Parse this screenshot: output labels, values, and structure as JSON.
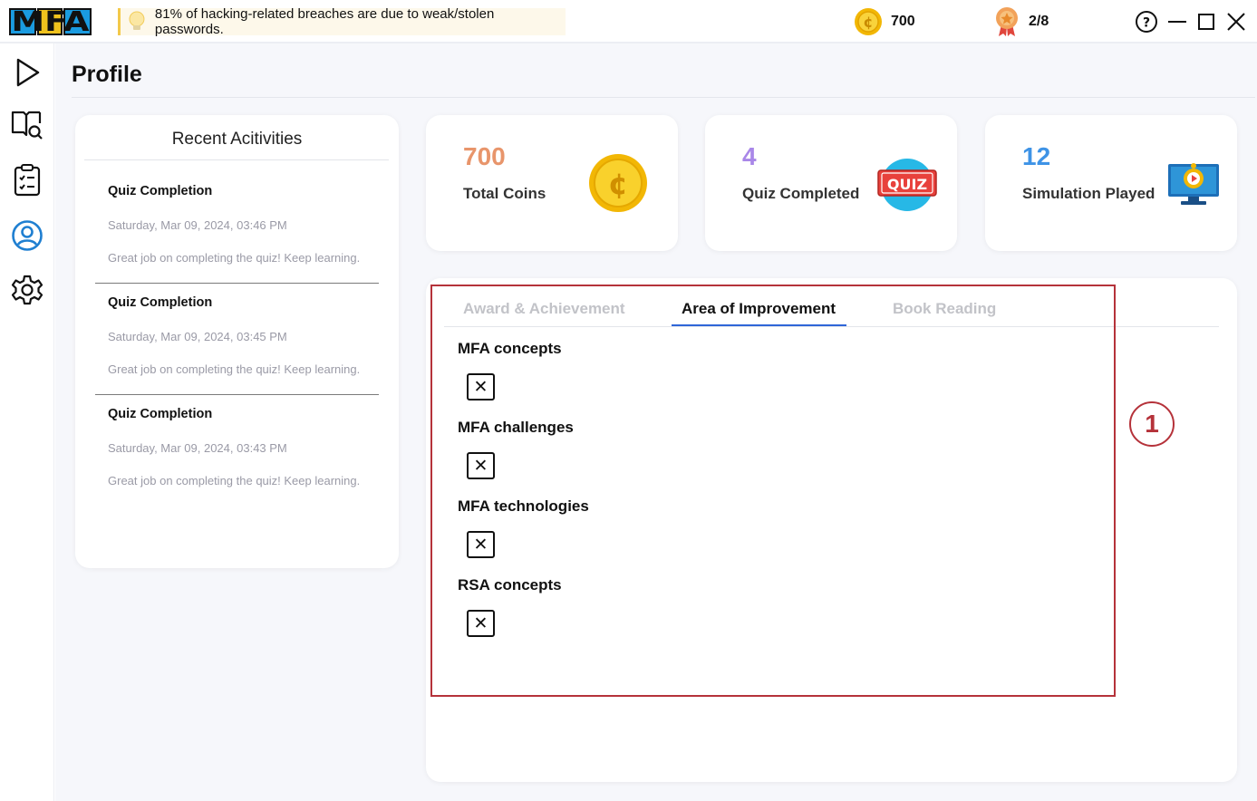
{
  "app": {
    "logo_text": "MFA",
    "tip": "81% of hacking-related breaches are due to weak/stolen passwords.",
    "coins": "700",
    "awards": "2/8"
  },
  "sidebar": {
    "items": [
      {
        "name": "play",
        "icon": "play-icon"
      },
      {
        "name": "book-search",
        "icon": "book-search-icon"
      },
      {
        "name": "checklist",
        "icon": "checklist-icon"
      },
      {
        "name": "profile",
        "icon": "user-circle-icon",
        "active": true
      },
      {
        "name": "settings",
        "icon": "gear-icon"
      }
    ]
  },
  "page": {
    "title": "Profile"
  },
  "recent": {
    "title": "Recent Acitivities",
    "items": [
      {
        "title": "Quiz Completion",
        "date": "Saturday, Mar 09, 2024, 03:46 PM",
        "message": "Great job on completing the quiz! Keep learning."
      },
      {
        "title": "Quiz Completion",
        "date": "Saturday, Mar 09, 2024, 03:45 PM",
        "message": "Great job on completing the quiz! Keep learning."
      },
      {
        "title": "Quiz Completion",
        "date": "Saturday, Mar 09, 2024, 03:43 PM",
        "message": "Great job on completing the quiz! Keep learning."
      }
    ]
  },
  "stats": {
    "coins": {
      "value": "700",
      "label": "Total Coins",
      "color": "#e8956b"
    },
    "quiz": {
      "value": "4",
      "label": "Quiz Completed",
      "color": "#a987e8",
      "badge": "QUIZ"
    },
    "simulation": {
      "value": "12",
      "label": "Simulation Played",
      "color": "#3e93e6"
    }
  },
  "tabs": {
    "award": "Award & Achievement",
    "improvement": "Area of Improvement",
    "reading": "Book Reading",
    "active": "improvement"
  },
  "improvement": {
    "topics": [
      {
        "name": "MFA concepts",
        "status": "✕"
      },
      {
        "name": "MFA challenges",
        "status": "✕"
      },
      {
        "name": "MFA technologies",
        "status": "✕"
      },
      {
        "name": "RSA concepts",
        "status": "✕"
      }
    ]
  },
  "annotation": {
    "marker": "1",
    "color": "#b5323a"
  }
}
